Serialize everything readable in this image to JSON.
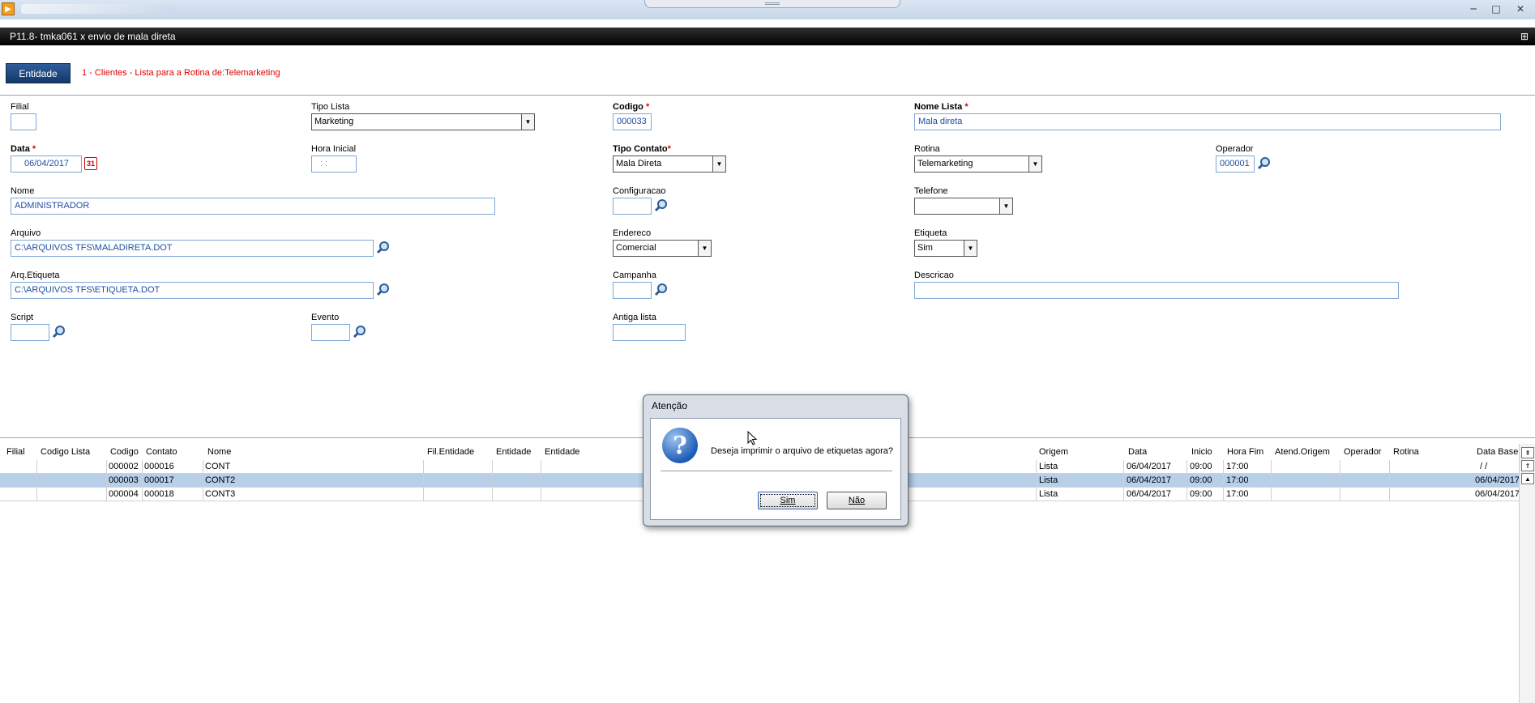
{
  "window": {
    "title": "P11.8- tmka061 x envio de mala direta",
    "minimize": "─",
    "maximize": "□",
    "close": "✕"
  },
  "entity": {
    "button": "Entidade",
    "description": "1 - Clientes - Lista para a Rotina de:Telemarketing"
  },
  "form": {
    "filial": {
      "label": "Filial",
      "value": ""
    },
    "tipo_lista": {
      "label": "Tipo Lista",
      "value": "Marketing"
    },
    "codigo": {
      "label": "Codigo",
      "value": "000033"
    },
    "nome_lista": {
      "label": "Nome Lista",
      "value": "Mala direta"
    },
    "data": {
      "label": "Data",
      "value": "06/04/2017"
    },
    "hora_inicial": {
      "label": "Hora Inicial",
      "value": ": :"
    },
    "tipo_contato": {
      "label": "Tipo Contato",
      "value": "Mala Direta"
    },
    "rotina": {
      "label": "Rotina",
      "value": "Telemarketing"
    },
    "operador": {
      "label": "Operador",
      "value": "000001"
    },
    "nome": {
      "label": "Nome",
      "value": "ADMINISTRADOR"
    },
    "configuracao": {
      "label": "Configuracao",
      "value": ""
    },
    "telefone": {
      "label": "Telefone",
      "value": ""
    },
    "arquivo": {
      "label": "Arquivo",
      "value": "C:\\ARQUIVOS TFS\\MALADIRETA.DOT"
    },
    "endereco": {
      "label": "Endereco",
      "value": "Comercial"
    },
    "etiqueta": {
      "label": "Etiqueta",
      "value": "Sim"
    },
    "arq_etiqueta": {
      "label": "Arq.Etiqueta",
      "value": "C:\\ARQUIVOS TFS\\ETIQUETA.DOT"
    },
    "campanha": {
      "label": "Campanha",
      "value": ""
    },
    "descricao": {
      "label": "Descricao",
      "value": ""
    },
    "script": {
      "label": "Script",
      "value": ""
    },
    "evento": {
      "label": "Evento",
      "value": ""
    },
    "antiga_lista": {
      "label": "Antiga lista",
      "value": ""
    },
    "required_mark": "*"
  },
  "grid": {
    "headers": [
      "Filial",
      "Codigo Lista",
      "Codigo",
      "Contato",
      "Nome",
      "Fil.Entidade",
      "Entidade",
      "Entidade",
      "Origem",
      "Data",
      "Inicio",
      "Hora Fim",
      "Atend.Origem",
      "Operador",
      "Rotina",
      "Data Base"
    ],
    "rows": [
      {
        "codigo": "000002",
        "contato": "000016",
        "nome": "CONT",
        "origem": "Lista",
        "data": "06/04/2017",
        "inicio": "09:00",
        "fim": "17:00",
        "data_base": " /  /"
      },
      {
        "codigo": "000003",
        "contato": "000017",
        "nome": "CONT2",
        "origem": "Lista",
        "data": "06/04/2017",
        "inicio": "09:00",
        "fim": "17:00",
        "data_base": "06/04/2017"
      },
      {
        "codigo": "000004",
        "contato": "000018",
        "nome": "CONT3",
        "origem": "Lista",
        "data": "06/04/2017",
        "inicio": "09:00",
        "fim": "17:00",
        "data_base": "06/04/2017"
      }
    ]
  },
  "dialog": {
    "title": "Atenção",
    "message": "Deseja imprimir o arquivo de etiquetas agora?",
    "yes": "Sim",
    "no": "Não"
  },
  "colors": {
    "title_bar": "#000000",
    "entity_button": "#1f4a82",
    "required": "#e00000",
    "input_text": "#1e4ea0",
    "selected_row": "#b7cfe8"
  }
}
